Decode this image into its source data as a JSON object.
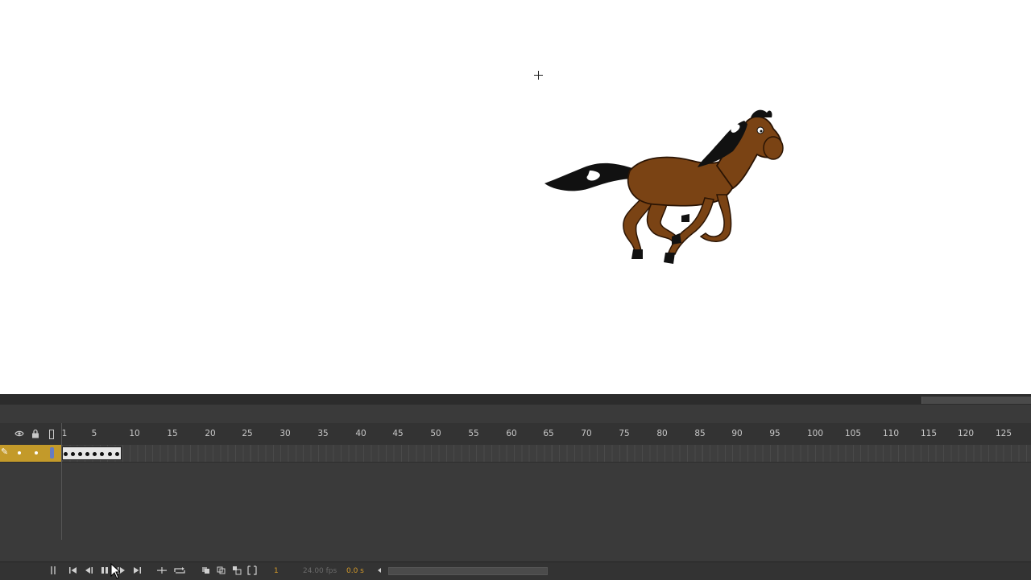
{
  "stage": {
    "registration_icon": "crosshair-icon",
    "sprite": "horse-illustration"
  },
  "timeline": {
    "header_icons": [
      "eye-icon",
      "lock-icon",
      "outline-icon"
    ],
    "ruler_labels": [
      "1",
      "5",
      "10",
      "15",
      "20",
      "25",
      "30",
      "35",
      "40",
      "45",
      "50",
      "55",
      "60",
      "65",
      "70",
      "75",
      "80",
      "85",
      "90",
      "95",
      "100",
      "105",
      "110",
      "115",
      "120",
      "125"
    ],
    "layer": {
      "active": true,
      "keyframe_count": 8
    },
    "toolbar": {
      "current_frame": "1",
      "fps": "24.00 fps",
      "elapsed_time": "0.0 s"
    }
  },
  "colors": {
    "layer_highlight": "#c39a2a",
    "accent_text": "#d49a2a",
    "panel_bg": "#3b3b3b",
    "horse_body": "#7a4314"
  }
}
